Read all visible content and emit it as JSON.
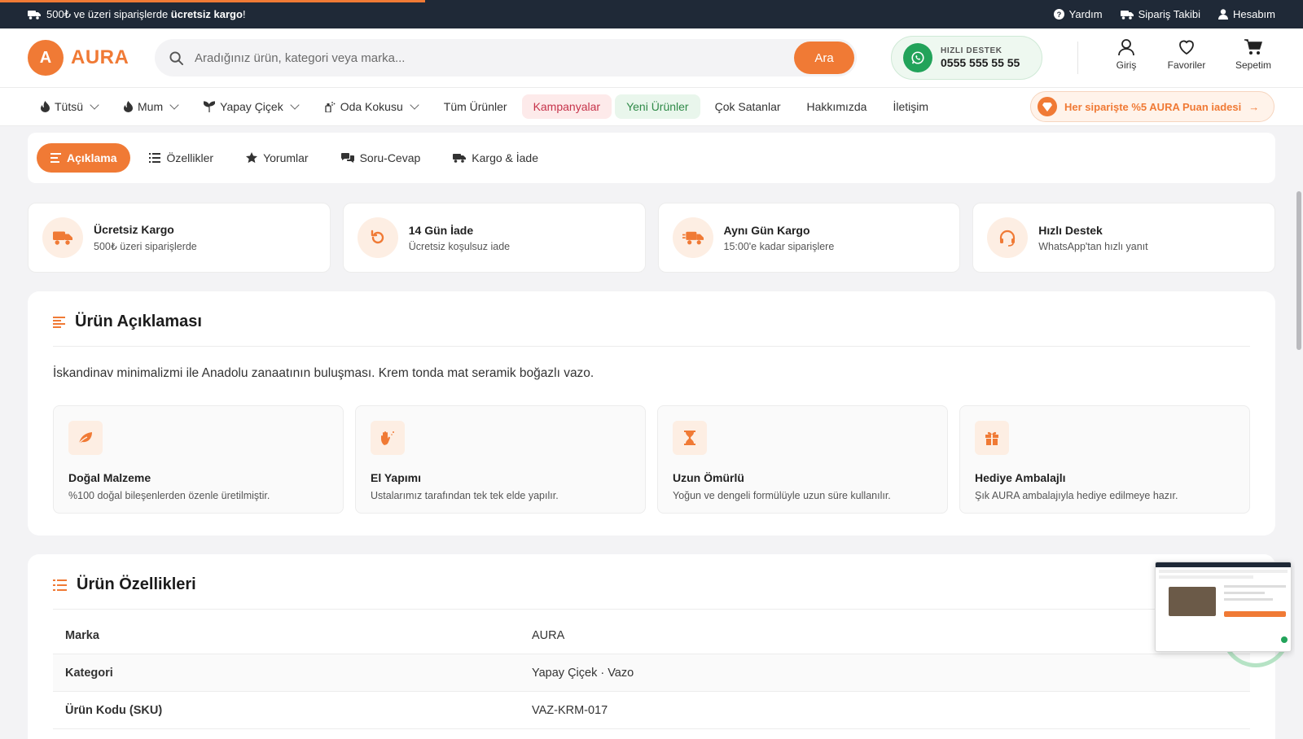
{
  "topbar": {
    "announcement_prefix": "500₺ ve üzeri siparişlerde ",
    "announcement_bold": "ücretsiz kargo",
    "announcement_suffix": "!",
    "links": [
      "Yardım",
      "Sipariş Takibi",
      "Hesabım"
    ]
  },
  "header": {
    "logo_letter": "A",
    "logo_name": "AURA",
    "search_placeholder": "Aradığınız ürün, kategori veya marka...",
    "search_button": "Ara",
    "support_label": "HIZLI DESTEK",
    "support_phone": "0555 555 55 55",
    "icons": [
      "Giriş",
      "Favoriler",
      "Sepetim"
    ]
  },
  "nav": {
    "items": [
      "Tütsü",
      "Mum",
      "Yapay Çiçek",
      "Oda Kokusu",
      "Tüm Ürünler",
      "Kampanyalar",
      "Yeni Ürünler",
      "Çok Satanlar",
      "Hakkımızda",
      "İletişim"
    ],
    "promo": "Her siparişte %5 AURA Puan iadesi"
  },
  "tabs": [
    "Açıklama",
    "Özellikler",
    "Yorumlar",
    "Soru-Cevap",
    "Kargo & İade"
  ],
  "features": [
    {
      "title": "Ücretsiz Kargo",
      "subtitle": "500₺ üzeri siparişlerde"
    },
    {
      "title": "14 Gün İade",
      "subtitle": "Ücretsiz koşulsuz iade"
    },
    {
      "title": "Aynı Gün Kargo",
      "subtitle": "15:00'e kadar siparişlere"
    },
    {
      "title": "Hızlı Destek",
      "subtitle": "WhatsApp'tan hızlı yanıt"
    }
  ],
  "description": {
    "heading": "Ürün Açıklaması",
    "text": "İskandinav minimalizmi ile Anadolu zanaatının buluşması. Krem tonda mat seramik boğazlı vazo.",
    "boxes": [
      {
        "title": "Doğal Malzeme",
        "subtitle": "%100 doğal bileşenlerden özenle üretilmiştir."
      },
      {
        "title": "El Yapımı",
        "subtitle": "Ustalarımız tarafından tek tek elde yapılır."
      },
      {
        "title": "Uzun Ömürlü",
        "subtitle": "Yoğun ve dengeli formülüyle uzun süre kullanılır."
      },
      {
        "title": "Hediye Ambalajlı",
        "subtitle": "Şık AURA ambalajıyla hediye edilmeye hazır."
      }
    ]
  },
  "specs": {
    "heading": "Ürün Özellikleri",
    "rows": [
      {
        "key": "Marka",
        "value": "AURA"
      },
      {
        "key": "Kategori",
        "value": "Yapay Çiçek · Vazo"
      },
      {
        "key": "Ürün Kodu (SKU)",
        "value": "VAZ-KRM-017"
      }
    ]
  },
  "colors": {
    "accent": "#f07a35",
    "dark": "#1f2937",
    "whatsapp": "#22a35a"
  }
}
